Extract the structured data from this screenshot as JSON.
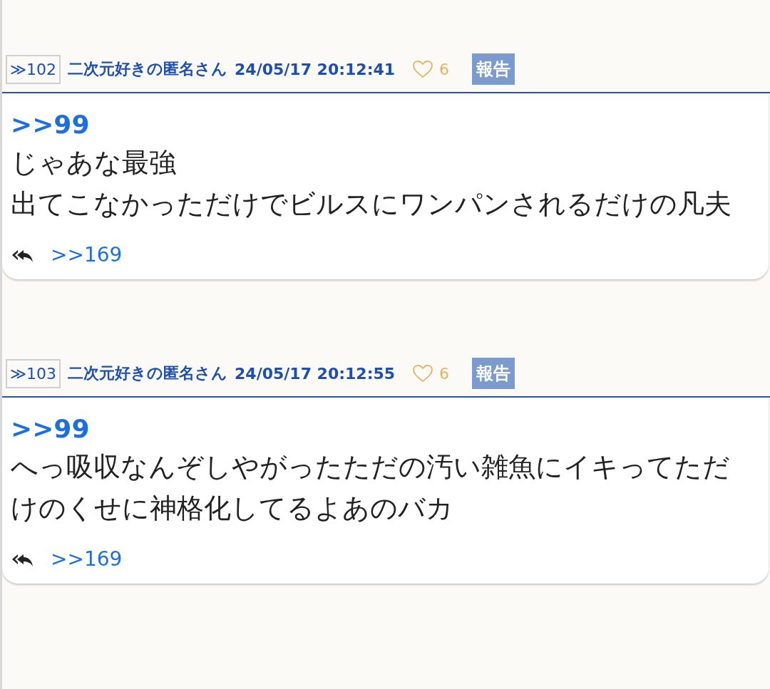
{
  "posts": [
    {
      "number": "≫102",
      "author": "二次元好きの匿名さん",
      "datetime": "24/05/17 20:12:41",
      "likes": "6",
      "report": "報告",
      "anchor": ">>99",
      "lines": [
        "じゃあな最強",
        "出てこなかっただけでビルスにワンパンされるだけの凡夫"
      ],
      "replies": [
        ">>169"
      ]
    },
    {
      "number": "≫103",
      "author": "二次元好きの匿名さん",
      "datetime": "24/05/17 20:12:55",
      "likes": "6",
      "report": "報告",
      "anchor": ">>99",
      "lines": [
        "へっ吸収なんぞしやがったただの汚い雑魚にイキってただけのくせに神格化してるよあのバカ"
      ],
      "replies": [
        ">>169"
      ]
    }
  ]
}
